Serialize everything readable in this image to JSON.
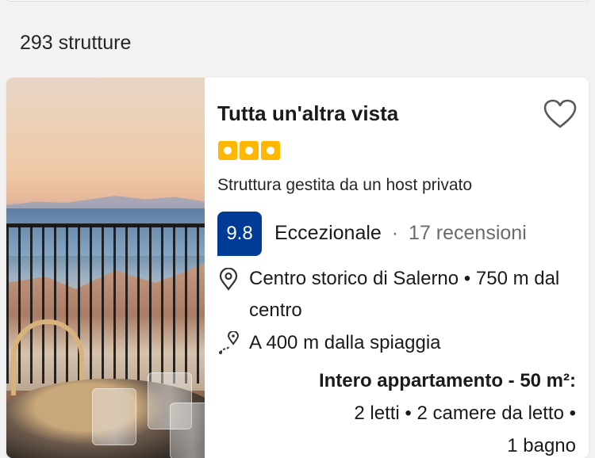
{
  "results": {
    "count_label": "293 strutture"
  },
  "property": {
    "name": "Tutta un'altra vista",
    "star_count": 3,
    "host_label": "Struttura gestita da un host privato",
    "score": "9.8",
    "rating_word": "Eccezionale",
    "separator": "·",
    "reviews_label": "17 recensioni",
    "location": "Centro storico di Salerno • 750 m dal centro",
    "beach": "A 400 m dalla spiaggia",
    "unit_title": "Intero appartamento - 50 m²:",
    "unit_details_1": "2 letti • 2 camere da letto •",
    "unit_details_2": "1 bagno"
  },
  "colors": {
    "score_bg": "#003b95",
    "star": "#ffb700"
  },
  "icons": {
    "favorite": "heart-outline-icon",
    "location": "map-pin-icon",
    "beach": "route-pin-icon"
  }
}
